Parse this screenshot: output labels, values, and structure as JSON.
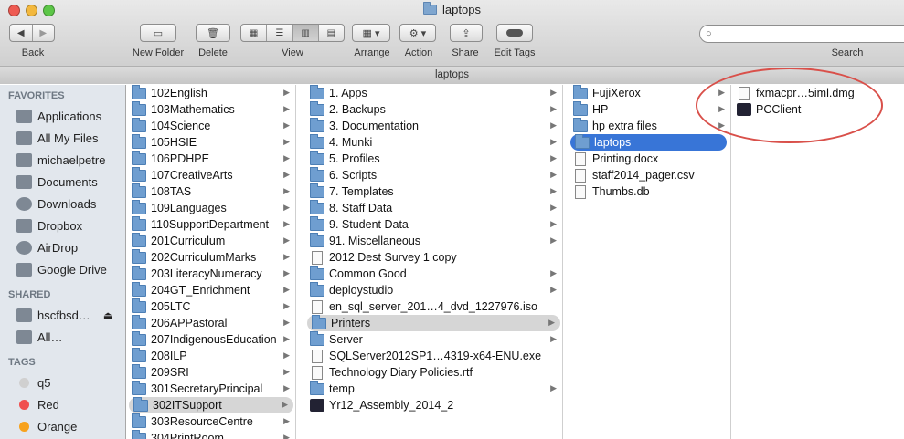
{
  "window": {
    "title": "laptops",
    "path_title": "laptops"
  },
  "toolbar": {
    "back_label": "Back",
    "new_folder_label": "New Folder",
    "delete_label": "Delete",
    "view_label": "View",
    "arrange_label": "Arrange",
    "action_label": "Action",
    "share_label": "Share",
    "edit_tags_label": "Edit Tags",
    "search_label": "Search"
  },
  "sidebar": {
    "favorites_header": "FAVORITES",
    "favorites": [
      {
        "label": "Applications",
        "icon": "applications-icon"
      },
      {
        "label": "All My Files",
        "icon": "all-my-files-icon"
      },
      {
        "label": "michaelpetre",
        "icon": "home-icon"
      },
      {
        "label": "Documents",
        "icon": "documents-icon"
      },
      {
        "label": "Downloads",
        "icon": "downloads-icon"
      },
      {
        "label": "Dropbox",
        "icon": "dropbox-icon"
      },
      {
        "label": "AirDrop",
        "icon": "airdrop-icon"
      },
      {
        "label": "Google Drive",
        "icon": "folder-icon"
      }
    ],
    "shared_header": "SHARED",
    "shared": [
      {
        "label": "hscfbsd…",
        "icon": "server-icon"
      },
      {
        "label": "All…",
        "icon": "network-icon"
      }
    ],
    "tags_header": "TAGS",
    "tags": [
      {
        "label": "q5",
        "color": "#d0d0d0"
      },
      {
        "label": "Red",
        "color": "#f05050"
      },
      {
        "label": "Orange",
        "color": "#f7a21d"
      }
    ]
  },
  "columns": {
    "col1": [
      "102English",
      "103Mathematics",
      "104Science",
      "105HSIE",
      "106PDHPE",
      "107CreativeArts",
      "108TAS",
      "109Languages",
      "110SupportDepartment",
      "201Curriculum",
      "202CurriculumMarks",
      "203LiteracyNumeracy",
      "204GT_Enrichment",
      "205LTC",
      "206APPastoral",
      "207IndigenousEducation",
      "208ILP",
      "209SRI",
      "301SecretaryPrincipal",
      "302ITSupport",
      "303ResourceCentre",
      "304PrintRoom"
    ],
    "col2": [
      {
        "label": "1. Apps",
        "kind": "folder"
      },
      {
        "label": "2. Backups",
        "kind": "folder"
      },
      {
        "label": "3. Documentation",
        "kind": "folder"
      },
      {
        "label": "4. Munki",
        "kind": "folder"
      },
      {
        "label": "5. Profiles",
        "kind": "folder"
      },
      {
        "label": "6. Scripts",
        "kind": "folder"
      },
      {
        "label": "7. Templates",
        "kind": "folder"
      },
      {
        "label": "8. Staff Data",
        "kind": "folder"
      },
      {
        "label": "9. Student Data",
        "kind": "folder"
      },
      {
        "label": "91. Miscellaneous",
        "kind": "folder"
      },
      {
        "label": "2012 Dest  Survey 1 copy",
        "kind": "doc"
      },
      {
        "label": "Common Good",
        "kind": "folder"
      },
      {
        "label": "deploystudio",
        "kind": "folder"
      },
      {
        "label": "en_sql_server_201…4_dvd_1227976.iso",
        "kind": "doc"
      },
      {
        "label": "Printers",
        "kind": "folder"
      },
      {
        "label": "Server",
        "kind": "folder"
      },
      {
        "label": "SQLServer2012SP1…4319-x64-ENU.exe",
        "kind": "doc"
      },
      {
        "label": "Technology Diary Policies.rtf",
        "kind": "doc"
      },
      {
        "label": "temp",
        "kind": "folder"
      },
      {
        "label": "Yr12_Assembly_2014_2",
        "kind": "app"
      }
    ],
    "col3": [
      {
        "label": "FujiXerox",
        "kind": "folder"
      },
      {
        "label": "HP",
        "kind": "folder"
      },
      {
        "label": "hp extra files",
        "kind": "folder"
      },
      {
        "label": "laptops",
        "kind": "folder"
      },
      {
        "label": "Printing.docx",
        "kind": "doc"
      },
      {
        "label": "staff2014_pager.csv",
        "kind": "doc"
      },
      {
        "label": "Thumbs.db",
        "kind": "doc"
      }
    ],
    "col4": [
      {
        "label": "fxmacpr…5iml.dmg",
        "kind": "doc"
      },
      {
        "label": "PCClient",
        "kind": "app"
      }
    ]
  },
  "colors": {
    "selection_blue": "#3875d7",
    "annotation_red": "#d9504a"
  }
}
